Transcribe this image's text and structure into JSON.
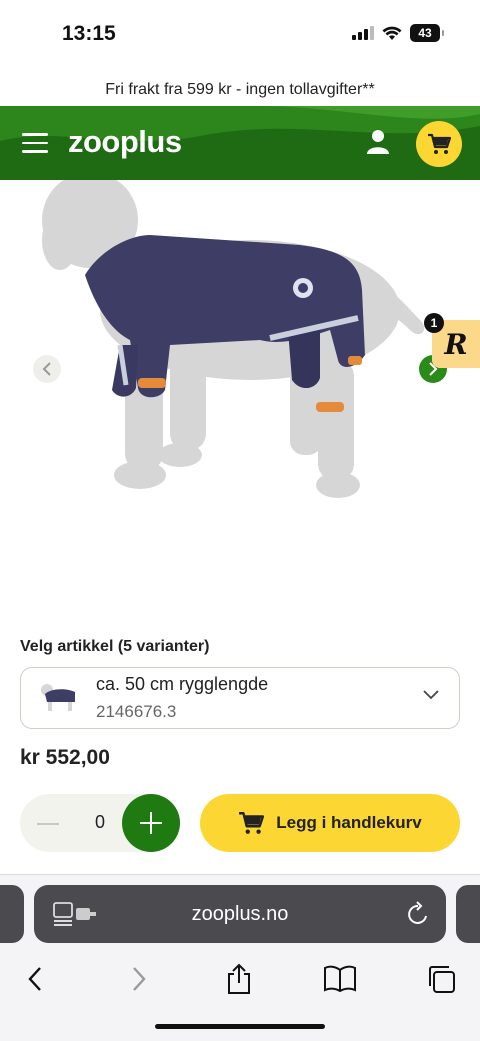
{
  "status_bar": {
    "time": "13:15",
    "battery": "43",
    "icons": [
      "signal-icon",
      "wifi-icon",
      "battery-icon"
    ]
  },
  "promo": {
    "text": "Fri frakt fra 599 kr - ingen tollavgifter**"
  },
  "header": {
    "logo": "zooplus",
    "menu_icon": "hamburger-menu-icon",
    "account_icon": "user-icon",
    "cart_icon": "cart-icon",
    "brand_color": "#1f6b14",
    "accent_color": "#fcd734"
  },
  "product_image": {
    "description_icon": "dog-raincoat-image",
    "prev_icon": "chevron-left-icon",
    "next_icon": "chevron-right-icon"
  },
  "reward_badge": {
    "letter": "R",
    "count": "1"
  },
  "variant": {
    "title": "Velg artikkel (5 varianter)",
    "selected_name": "ca. 50 cm rygglengde",
    "selected_sku": "2146676.3"
  },
  "price": {
    "text": "kr 552,00"
  },
  "quantity": {
    "value": "0"
  },
  "add_to_cart": {
    "label": "Legg i handlekurv"
  },
  "browser": {
    "url": "zooplus.no",
    "nav_icons": [
      "back-icon",
      "forward-icon",
      "share-icon",
      "bookmarks-icon",
      "tabs-icon"
    ]
  }
}
